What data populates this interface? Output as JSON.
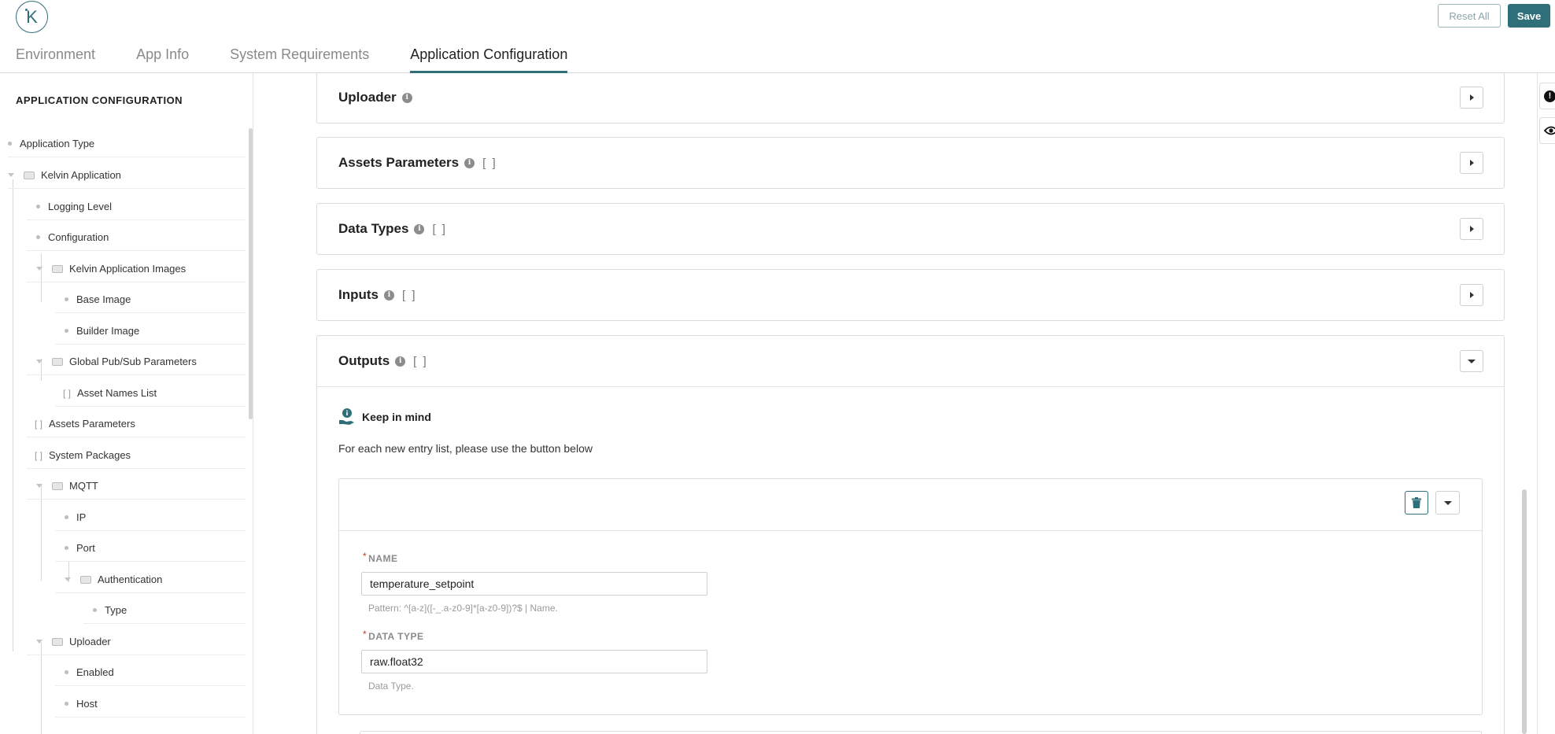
{
  "header": {
    "logo_letter": "K",
    "reset_label": "Reset All",
    "save_label": "Save",
    "tabs": [
      {
        "label": "Environment"
      },
      {
        "label": "App Info"
      },
      {
        "label": "System Requirements"
      },
      {
        "label": "Application Configuration"
      }
    ],
    "active_tab": "Application Configuration"
  },
  "sidebar": {
    "title": "APPLICATION CONFIGURATION",
    "items": [
      {
        "label": "Application Type",
        "kind": "leaf",
        "depth": 0
      },
      {
        "label": "Kelvin Application",
        "kind": "object",
        "depth": 0
      },
      {
        "label": "Logging Level",
        "kind": "leaf",
        "depth": 1
      },
      {
        "label": "Configuration",
        "kind": "leaf",
        "depth": 1
      },
      {
        "label": "Kelvin Application Images",
        "kind": "object",
        "depth": 1
      },
      {
        "label": "Base Image",
        "kind": "leaf",
        "depth": 2
      },
      {
        "label": "Builder Image",
        "kind": "leaf",
        "depth": 2
      },
      {
        "label": "Global Pub/Sub Parameters",
        "kind": "object",
        "depth": 1
      },
      {
        "label": "Asset Names List",
        "kind": "array",
        "depth": 2
      },
      {
        "label": "Assets Parameters",
        "kind": "array",
        "depth": 1
      },
      {
        "label": "System Packages",
        "kind": "array",
        "depth": 1
      },
      {
        "label": "MQTT",
        "kind": "object",
        "depth": 1
      },
      {
        "label": "IP",
        "kind": "leaf",
        "depth": 2
      },
      {
        "label": "Port",
        "kind": "leaf",
        "depth": 2
      },
      {
        "label": "Authentication",
        "kind": "object",
        "depth": 2
      },
      {
        "label": "Type",
        "kind": "leaf",
        "depth": 3
      },
      {
        "label": "Uploader",
        "kind": "object",
        "depth": 1
      },
      {
        "label": "Enabled",
        "kind": "leaf",
        "depth": 2
      },
      {
        "label": "Host",
        "kind": "leaf",
        "depth": 2
      }
    ],
    "array_marker": "[ ]"
  },
  "main": {
    "panels": [
      {
        "title": "Uploader",
        "has_brackets": false,
        "brackets": "",
        "expanded": false
      },
      {
        "title": "Assets Parameters",
        "has_brackets": true,
        "brackets": "[ ]",
        "expanded": false
      },
      {
        "title": "Data Types",
        "has_brackets": true,
        "brackets": "[ ]",
        "expanded": false
      },
      {
        "title": "Inputs",
        "has_brackets": true,
        "brackets": "[ ]",
        "expanded": false
      },
      {
        "title": "Outputs",
        "has_brackets": true,
        "brackets": "[ ]",
        "expanded": true
      }
    ],
    "outputs": {
      "keep_in_mind_title": "Keep in mind",
      "keep_in_mind_text": "For each new entry list, please use the button below",
      "entry": {
        "name_label": "NAME",
        "name_value": "temperature_setpoint",
        "name_hint": "Pattern: ^[a-z]([-_.a-z0-9]*[a-z0-9])?$ | Name.",
        "data_type_label": "DATA TYPE",
        "data_type_value": "raw.float32",
        "data_type_hint": "Data Type.",
        "required_marker": "*"
      }
    }
  },
  "icons": {
    "info": "info-icon",
    "trash": "trash-icon",
    "warning": "exclamation-icon",
    "preview": "eye-icon",
    "keep_in_mind": "hand-info-icon"
  },
  "colors": {
    "accent": "#2f6f7a",
    "required": "#c0392b"
  }
}
